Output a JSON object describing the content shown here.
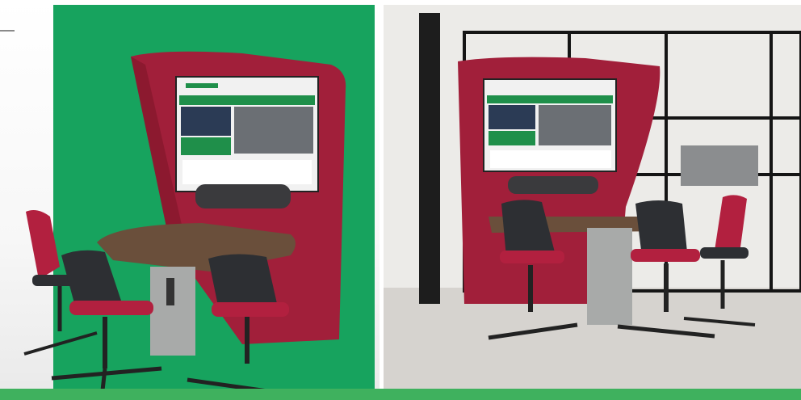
{
  "colors": {
    "green_backdrop": "#17a35e",
    "partition_red": "#a11f3a",
    "partition_red_dark": "#7e1528",
    "tabletop_wood": "#6a4f3b",
    "pedestal_grey": "#a8aaa9",
    "chair_shell": "#2d2f33",
    "chair_seat": "#b2203f",
    "screen_green": "#1f8f4a",
    "bottom_strip": "#3fb15e",
    "office_floor": "#d6d3cf",
    "glass_frame": "#151515"
  }
}
